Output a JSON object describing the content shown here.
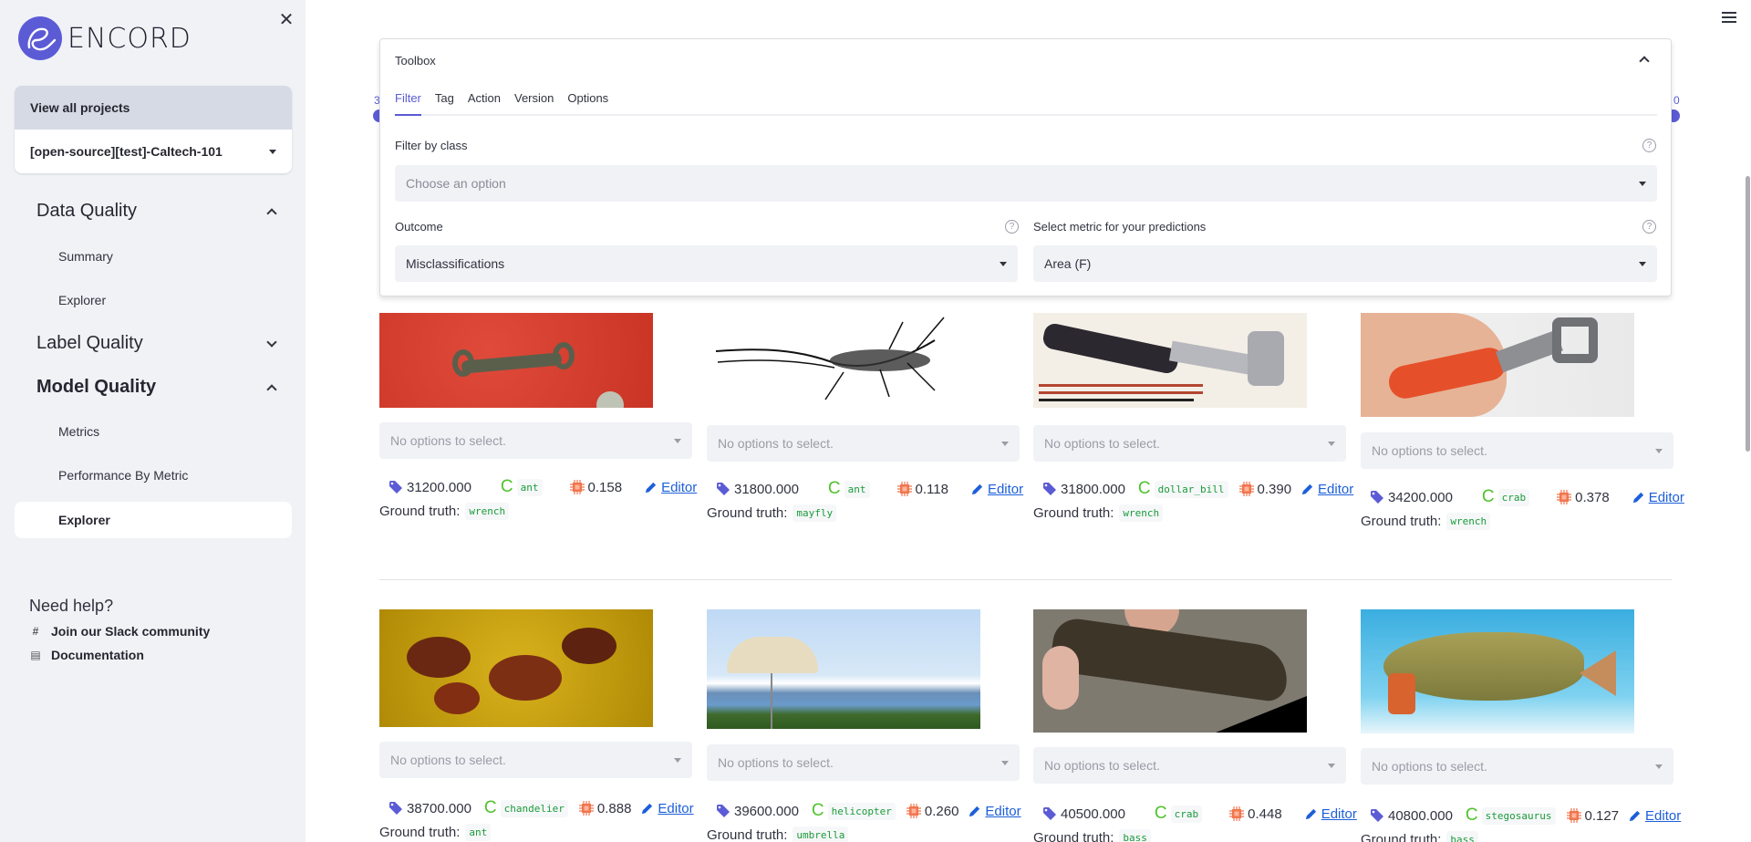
{
  "sidebar": {
    "brand": "ENCORD",
    "close_icon": "close-icon",
    "view_all_projects": "View all projects",
    "project_selected": "[open-source][test]-Caltech-101",
    "sections": [
      {
        "label": "Data Quality",
        "expanded": true,
        "items": [
          "Summary",
          "Explorer"
        ]
      },
      {
        "label": "Label Quality",
        "expanded": false,
        "items": []
      },
      {
        "label": "Model Quality",
        "expanded": true,
        "items": [
          "Metrics",
          "Performance By Metric",
          "Explorer"
        ]
      }
    ],
    "selected_item": "Model Quality / Explorer",
    "help": {
      "title": "Need help?",
      "links": [
        {
          "label": "Join our Slack community",
          "icon": "slack-icon"
        },
        {
          "label": "Documentation",
          "icon": "document-icon"
        }
      ]
    }
  },
  "background_slider": {
    "left_label": "3",
    "right_label": "0"
  },
  "toolbox": {
    "title": "Toolbox",
    "tabs": [
      "Filter",
      "Tag",
      "Action",
      "Version",
      "Options"
    ],
    "active_tab": "Filter",
    "filter_by_class": {
      "label": "Filter by class",
      "placeholder": "Choose an option"
    },
    "outcome": {
      "label": "Outcome",
      "value": "Misclassifications"
    },
    "metric": {
      "label": "Select metric for your predictions",
      "value": "Area (F)"
    }
  },
  "colors": {
    "accent": "#5b5bd6",
    "sidebar_bg": "#f0f2f6",
    "code_text": "#1a9c3a",
    "link": "#1c5fd9",
    "class_icon": "#4fc32c",
    "chip_icon": "#f0764f"
  },
  "cards": [
    {
      "tag_select": "No options to select.",
      "metric_value": "31200.000",
      "predicted": "ant",
      "score": "0.158",
      "editor": "Editor",
      "gt_label": "Ground truth:",
      "ground_truth": "wrench",
      "image": "red background wrench"
    },
    {
      "tag_select": "No options to select.",
      "metric_value": "31800.000",
      "predicted": "ant",
      "score": "0.118",
      "editor": "Editor",
      "gt_label": "Ground truth:",
      "ground_truth": "mayfly",
      "image": "mayfly line drawing"
    },
    {
      "tag_select": "No options to select.",
      "metric_value": "31800.000",
      "predicted": "dollar_bill",
      "score": "0.390",
      "editor": "Editor",
      "gt_label": "Ground truth:",
      "ground_truth": "wrench",
      "image": "adjustable wrench ad"
    },
    {
      "tag_select": "No options to select.",
      "metric_value": "34200.000",
      "predicted": "crab",
      "score": "0.378",
      "editor": "Editor",
      "gt_label": "Ground truth:",
      "ground_truth": "wrench",
      "image": "hand holding red wrench"
    },
    {
      "tag_select": "No options to select.",
      "metric_value": "38700.000",
      "predicted": "chandelier",
      "score": "0.888",
      "editor": "Editor",
      "gt_label": "Ground truth:",
      "ground_truth": "ant",
      "image": "ants on yellow"
    },
    {
      "tag_select": "No options to select.",
      "metric_value": "39600.000",
      "predicted": "helicopter",
      "score": "0.260",
      "editor": "Editor",
      "gt_label": "Ground truth:",
      "ground_truth": "umbrella",
      "image": "umbrella with mountains"
    },
    {
      "tag_select": "No options to select.",
      "metric_value": "40500.000",
      "predicted": "crab",
      "score": "0.448",
      "editor": "Editor",
      "gt_label": "Ground truth:",
      "ground_truth": "bass",
      "image": "person holding bass"
    },
    {
      "tag_select": "No options to select.",
      "metric_value": "40800.000",
      "predicted": "stegosaurus",
      "score": "0.127",
      "editor": "Editor",
      "gt_label": "Ground truth:",
      "ground_truth": "bass",
      "image": "bass fish on blue"
    }
  ]
}
